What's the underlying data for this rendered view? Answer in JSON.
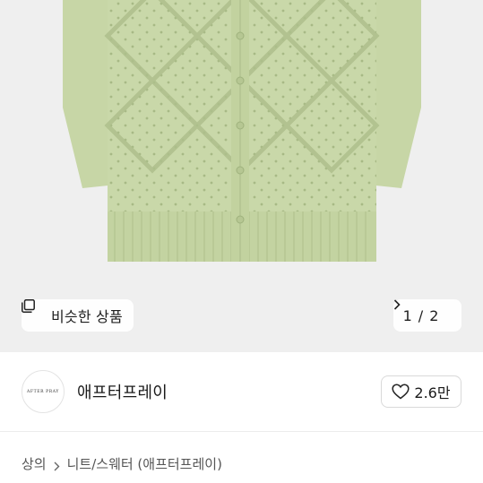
{
  "gallery": {
    "similar_label": "비슷한 상품",
    "pager_current": "1",
    "pager_separator": "/",
    "pager_total": "2"
  },
  "seller": {
    "logo_text": "AFTER PRAY",
    "name": "애프터프레이",
    "like_count": "2.6만"
  },
  "breadcrumb": {
    "level1": "상의",
    "level2": "니트/스웨터 (애프터프레이)"
  },
  "colors": {
    "garment": "#c7d6a6",
    "garment_shadow": "#a9bb88",
    "image_bg": "#efefef"
  },
  "icons": [
    "similar-items-icon",
    "chevron-right-icon",
    "heart-outline-icon"
  ]
}
